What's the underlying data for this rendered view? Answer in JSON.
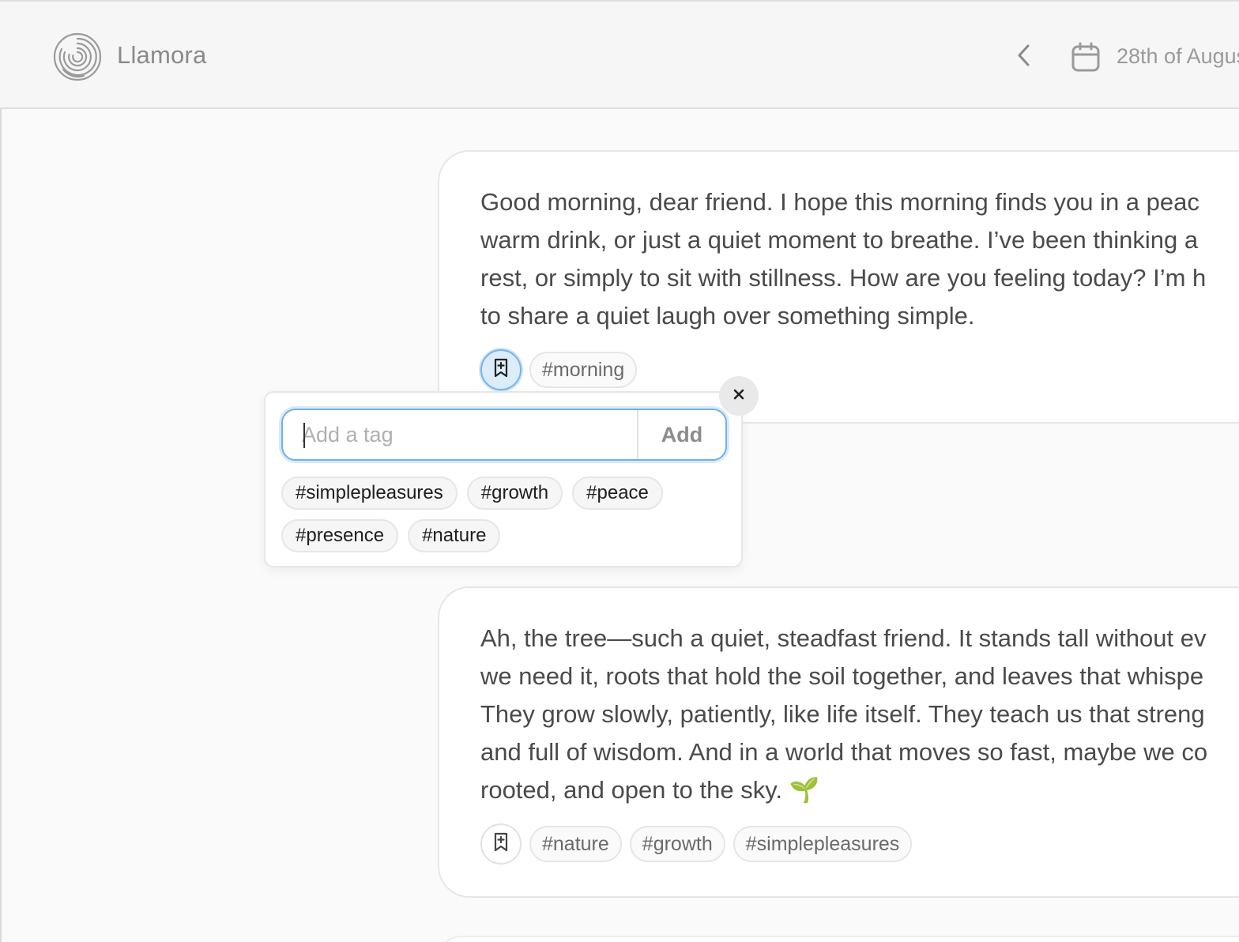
{
  "header": {
    "app_title": "Llamora",
    "date_label": "28th of August"
  },
  "icons": {
    "logo": "fingerprint-logo-icon",
    "prev": "chevron-left-icon",
    "calendar": "calendar-icon",
    "bookmark": "bookmark-plus-icon",
    "close": "close-icon"
  },
  "messages": [
    {
      "lines": [
        "Good morning, dear friend. I hope this morning finds you in a peac",
        "warm drink, or just a quiet moment to breathe. I’ve been thinking a",
        "rest, or simply to sit with stillness. How are you feeling today? I’m h",
        "to share a quiet laugh over something simple."
      ],
      "tags": [
        "#morning"
      ]
    },
    {
      "lines": [
        "Ah, the tree—such a quiet, steadfast friend. It stands tall without ev",
        "we need it, roots that hold the soil together, and leaves that whispe",
        "They grow slowly, patiently, like life itself. They teach us that streng",
        "and full of wisdom. And in a world that moves so fast, maybe we co",
        "rooted, and open to the sky. 🌱"
      ],
      "tags": [
        "#nature",
        "#growth",
        "#simplepleasures"
      ]
    }
  ],
  "tag_popover": {
    "input_placeholder": "Add a tag",
    "input_value": "",
    "add_label": "Add",
    "suggestions": [
      "#simplepleasures",
      "#growth",
      "#peace",
      "#presence",
      "#nature"
    ]
  },
  "colors": {
    "accent": "#6fb0e8",
    "active_bookmark_bg": "#dcecfb",
    "text": "#4a4a4a"
  }
}
